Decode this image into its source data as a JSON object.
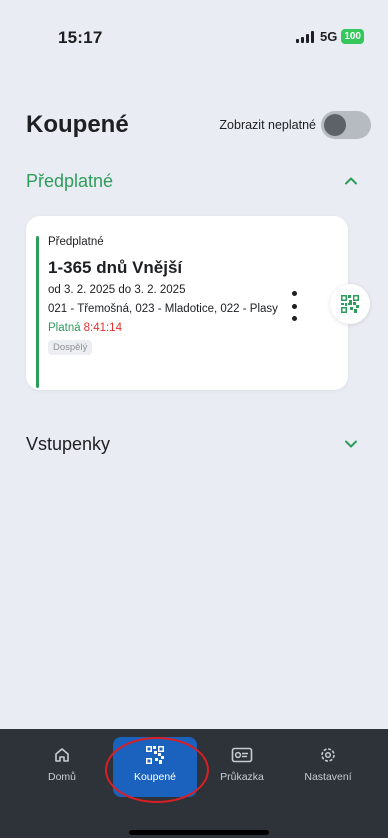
{
  "status_bar": {
    "time": "15:17",
    "network": "5G",
    "battery": "100"
  },
  "header": {
    "title": "Koupené",
    "toggle_label": "Zobrazit neplatné",
    "toggle_on": false
  },
  "sections": {
    "subscriptions": {
      "title": "Předplatné",
      "expanded": true
    },
    "tickets": {
      "title": "Vstupenky",
      "expanded": false
    }
  },
  "ticket": {
    "type": "Předplatné",
    "name": "1-365 dnů Vnější",
    "dates": "od 3. 2. 2025 do 3. 2. 2025",
    "zones": "021 - Třemošná, 023 - Mladotice, 022 - Plasy",
    "validity_label": "Platná",
    "remaining": "8:41:14",
    "badge": "Dospělý"
  },
  "tabbar": {
    "items": [
      {
        "label": "Domů",
        "icon": "home-icon"
      },
      {
        "label": "Koupené",
        "icon": "qr-code-icon",
        "active": true
      },
      {
        "label": "Průkazka",
        "icon": "id-card-icon"
      },
      {
        "label": "Nastavení",
        "icon": "gear-icon"
      }
    ]
  },
  "colors": {
    "accent_green": "#2e9d5b",
    "active_blue": "#1a62bd",
    "timer_red": "#e5302b",
    "tabbar_bg": "#2d3338",
    "annotation_red": "#d91f26"
  }
}
